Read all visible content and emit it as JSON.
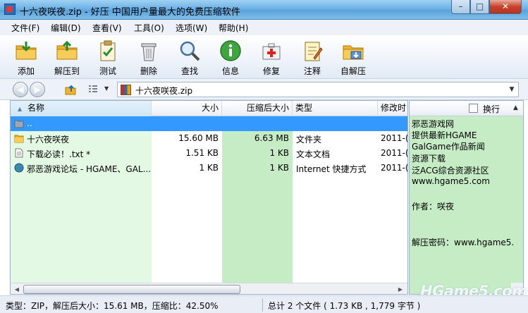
{
  "window": {
    "title": "十六夜咲夜.zip - 好压 中国用户量最大的免费压缩软件",
    "minimize_glyph": "–",
    "maximize_glyph": "□",
    "close_glyph": "✕"
  },
  "menu": [
    "文件(F)",
    "编辑(D)",
    "查看(V)",
    "工具(O)",
    "选项(W)",
    "帮助(H)"
  ],
  "toolbar": [
    {
      "label": "添加",
      "icon": "add-folder-icon"
    },
    {
      "label": "解压到",
      "icon": "extract-folder-icon"
    },
    {
      "label": "测试",
      "icon": "test-clipboard-icon"
    },
    {
      "label": "删除",
      "icon": "trash-icon"
    },
    {
      "label": "查找",
      "icon": "magnifier-icon"
    },
    {
      "label": "信息",
      "icon": "info-icon"
    },
    {
      "label": "修复",
      "icon": "first-aid-kit-icon"
    },
    {
      "label": "注释",
      "icon": "notepad-icon"
    },
    {
      "label": "自解压",
      "icon": "self-extract-folder-icon"
    }
  ],
  "address": {
    "path": "十六夜咲夜.zip",
    "dropdown_glyph": "▼"
  },
  "columns": {
    "name": "名称",
    "size": "大小",
    "packed": "压缩后大小",
    "type": "类型",
    "modified": "修改时"
  },
  "rows": [
    {
      "name": "..",
      "size": "",
      "packed": "",
      "type": "",
      "modified": "",
      "icon": "parent-folder-icon",
      "selected": true
    },
    {
      "name": "十六夜咲夜",
      "size": "15.60 MB",
      "packed": "6.63 MB",
      "type": "文件夹",
      "modified": "2011-(",
      "icon": "folder-icon",
      "selected": false
    },
    {
      "name": "下载必读！.txt *",
      "size": "1.51 KB",
      "packed": "1 KB",
      "type": "文本文档",
      "modified": "2011-(",
      "icon": "text-file-icon",
      "selected": false
    },
    {
      "name": "邪恶游戏论坛 - HGAME、GAL...",
      "size": "1 KB",
      "packed": "1 KB",
      "type": "Internet 快捷方式",
      "modified": "2011-(",
      "icon": "internet-shortcut-icon",
      "selected": false
    }
  ],
  "info_panel": {
    "wrap_label": "换行",
    "lines": [
      "邪恶游戏网",
      "提供最新HGAME",
      "GalGame作品新闻",
      "资源下载",
      "泛ACG综合资源社区",
      "www.hgame5.com",
      "",
      "作者：咲夜",
      "",
      "",
      "",
      "解压密码：www.hgame5."
    ]
  },
  "watermark": "HGame5.com",
  "status": {
    "left": "类型：ZIP，解压后大小：15.61 MB，压缩比：42.50%",
    "right": "总计 2 个文件 ( 1.73 KB , 1,779 字节 )"
  },
  "colors": {
    "selection": "#3399ff",
    "name_column_tint": "#e4f9e4",
    "packed_column_tint": "#c6ecc6",
    "info_panel": "#c6ecc6"
  }
}
